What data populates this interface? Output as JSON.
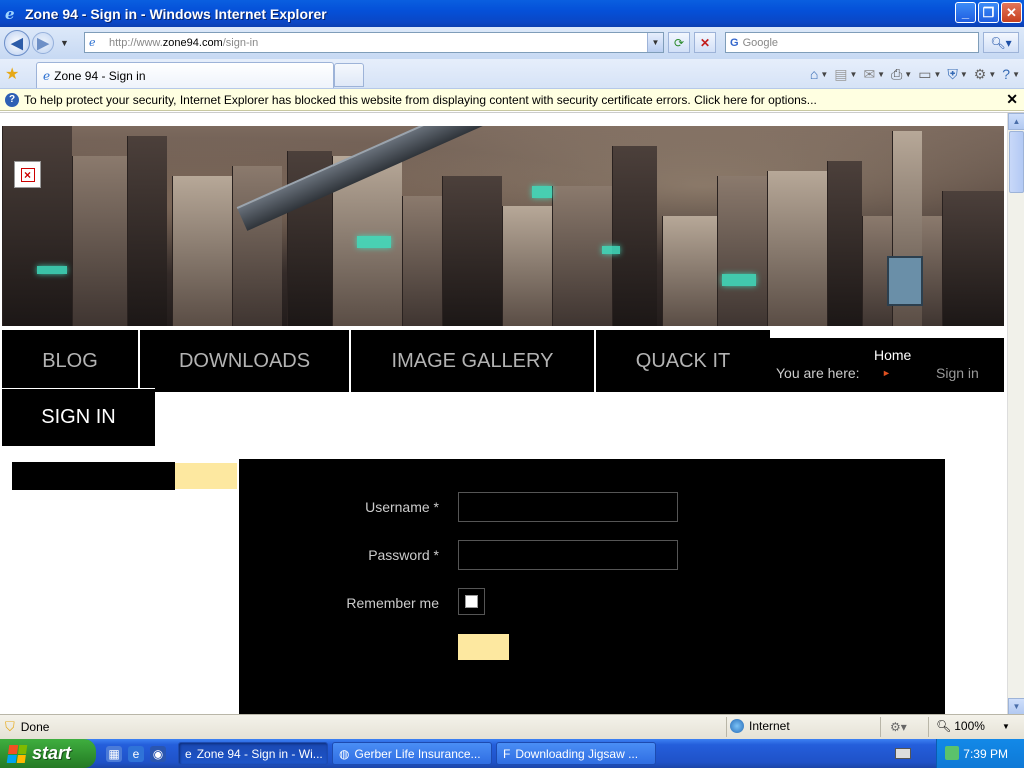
{
  "window": {
    "title": "Zone 94 - Sign in - Windows Internet Explorer"
  },
  "address_bar": {
    "url_prefix": "http://www.",
    "url_host": "zone94.com",
    "url_path": "/sign-in"
  },
  "search_box": {
    "placeholder": "Google",
    "engine_label": "G"
  },
  "tabs": [
    {
      "label": "Zone 94 - Sign in"
    }
  ],
  "infobar": {
    "message": "To help protect your security, Internet Explorer has blocked this website from displaying content with security certificate errors. Click here for options..."
  },
  "site": {
    "menu": {
      "blog": "BLOG",
      "downloads": "DOWNLOADS",
      "image_gallery": "IMAGE GALLERY",
      "quack_it": "QUACK IT",
      "sign_in": "SIGN IN"
    },
    "breadcrumbs": {
      "label": "You are here:",
      "home": "Home",
      "current": "Sign in"
    },
    "login_form": {
      "username_label": "Username *",
      "password_label": "Password *",
      "remember_label": "Remember me",
      "username_value": "",
      "password_value": ""
    }
  },
  "status_bar": {
    "status_text": "Done",
    "zone": "Internet",
    "zoom": "100%"
  },
  "taskbar": {
    "start_label": "start",
    "items": [
      {
        "label": "Zone 94 - Sign in - Wi...",
        "active": true
      },
      {
        "label": "Gerber Life Insurance...",
        "active": false
      },
      {
        "label": "Downloading Jigsaw ...",
        "active": false
      }
    ],
    "clock": "7:39 PM"
  },
  "colors": {
    "xp_blue": "#0a5fe0",
    "site_black": "#000000",
    "accent_cream": "#fde8a0"
  }
}
